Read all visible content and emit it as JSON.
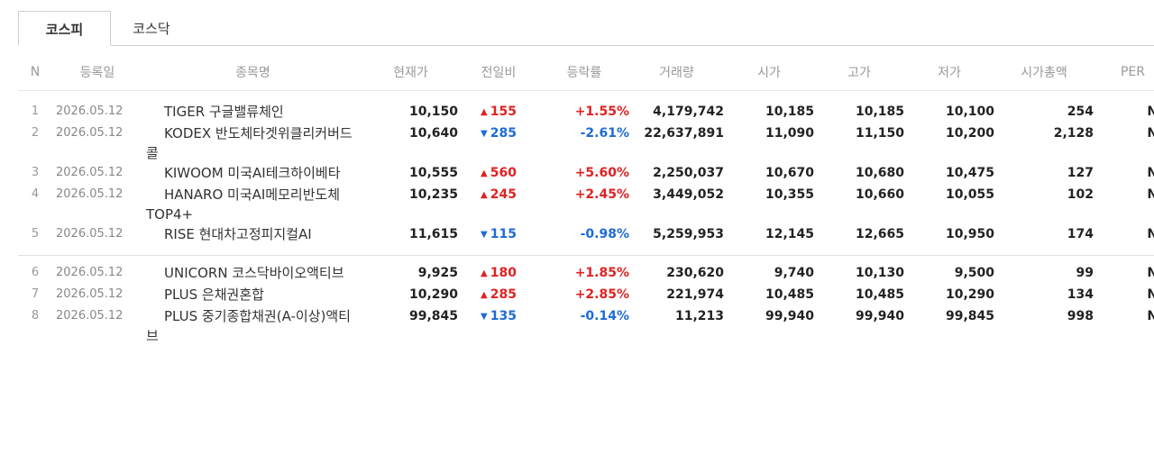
{
  "tabs": [
    {
      "label": "코스피",
      "active": true
    },
    {
      "label": "코스닥",
      "active": false
    }
  ],
  "columns": [
    "N",
    "등록일",
    "종목명",
    "현재가",
    "전일비",
    "등락률",
    "거래량",
    "시가",
    "고가",
    "저가",
    "시가총액",
    "PER"
  ],
  "colors": {
    "up": "#e02222",
    "down": "#1e6bd6"
  },
  "rows": [
    {
      "n": "1",
      "date": "2026.05.12",
      "name": "TIGER 구글밸류체인",
      "price": "10,150",
      "dir": "up",
      "change": "155",
      "rate": "+1.55%",
      "volume": "4,179,742",
      "open": "10,185",
      "high": "10,185",
      "low": "10,100",
      "cap": "254",
      "per": "N/A"
    },
    {
      "n": "2",
      "date": "2026.05.12",
      "name": "KODEX 반도체타겟위클리커버드콜",
      "price": "10,640",
      "dir": "down",
      "change": "285",
      "rate": "-2.61%",
      "volume": "22,637,891",
      "open": "11,090",
      "high": "11,150",
      "low": "10,200",
      "cap": "2,128",
      "per": "N/A"
    },
    {
      "n": "3",
      "date": "2026.05.12",
      "name": "KIWOOM 미국AI테크하이베타",
      "price": "10,555",
      "dir": "up",
      "change": "560",
      "rate": "+5.60%",
      "volume": "2,250,037",
      "open": "10,670",
      "high": "10,680",
      "low": "10,475",
      "cap": "127",
      "per": "N/A"
    },
    {
      "n": "4",
      "date": "2026.05.12",
      "name": "HANARO 미국AI메모리반도체TOP4+",
      "price": "10,235",
      "dir": "up",
      "change": "245",
      "rate": "+2.45%",
      "volume": "3,449,052",
      "open": "10,355",
      "high": "10,660",
      "low": "10,055",
      "cap": "102",
      "per": "N/A"
    },
    {
      "n": "5",
      "date": "2026.05.12",
      "name": "RISE 현대차고정피지컬AI",
      "price": "11,615",
      "dir": "down",
      "change": "115",
      "rate": "-0.98%",
      "volume": "5,259,953",
      "open": "12,145",
      "high": "12,665",
      "low": "10,950",
      "cap": "174",
      "per": "N/A"
    },
    {
      "n": "6",
      "date": "2026.05.12",
      "name": "UNICORN 코스닥바이오액티브",
      "price": "9,925",
      "dir": "up",
      "change": "180",
      "rate": "+1.85%",
      "volume": "230,620",
      "open": "9,740",
      "high": "10,130",
      "low": "9,500",
      "cap": "99",
      "per": "N/A"
    },
    {
      "n": "7",
      "date": "2026.05.12",
      "name": "PLUS 은채권혼합",
      "price": "10,290",
      "dir": "up",
      "change": "285",
      "rate": "+2.85%",
      "volume": "221,974",
      "open": "10,485",
      "high": "10,485",
      "low": "10,290",
      "cap": "134",
      "per": "N/A"
    },
    {
      "n": "8",
      "date": "2026.05.12",
      "name": "PLUS 중기종합채권(A-이상)액티브",
      "price": "99,845",
      "dir": "down",
      "change": "135",
      "rate": "-0.14%",
      "volume": "11,213",
      "open": "99,940",
      "high": "99,940",
      "low": "99,845",
      "cap": "998",
      "per": "N/A"
    }
  ]
}
